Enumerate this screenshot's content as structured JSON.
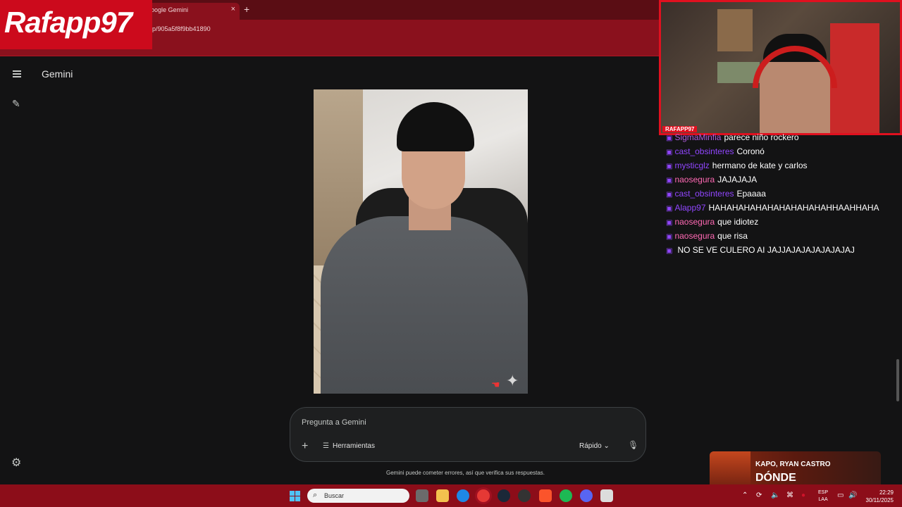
{
  "browser": {
    "tab_title": "oogle Gemini",
    "close_glyph": "×",
    "new_tab_glyph": "+",
    "url": "p/905a5f8f9bb41890"
  },
  "overlay": {
    "logo_text": "Rafapp97",
    "webcam_label": "RAFAPP97"
  },
  "gemini": {
    "app_title": "Gemini",
    "prompt_placeholder": "Pregunta a Gemini",
    "plus_glyph": "+",
    "tools_label": "Herramientas",
    "mode_label": "Rápido",
    "disclaimer": "Gemini puede cometer errores, así que verifica sus respuestas."
  },
  "chat": {
    "messages": [
      {
        "user": "SigmaMinfia",
        "text": "parece niño rockero",
        "color": "#b15be0"
      },
      {
        "user": "cast_obsinteres",
        "text": "Coronó",
        "color": "#9146ff"
      },
      {
        "user": "mysticglz",
        "text": "hermano de kate y carlos",
        "color": "#9146ff"
      },
      {
        "user": "naosegura",
        "text": "JAJAJAJA",
        "color": "#ff69b4"
      },
      {
        "user": "cast_obsinteres",
        "text": "Epaaaa",
        "color": "#9146ff"
      },
      {
        "user": "Alapp97",
        "text": "HAHAHAHAHAHAHAHAHAHAHHAAHHAHA",
        "color": "#9146ff"
      },
      {
        "user": "naosegura",
        "text": "que idiotez",
        "color": "#ff69b4"
      },
      {
        "user": "naosegura",
        "text": "que risa",
        "color": "#ff69b4"
      },
      {
        "user": "",
        "text": "NO SE VE CULERO AI JAJJAJAJAJAJAJAJAJ",
        "color": "#1f3fd6"
      }
    ]
  },
  "now_playing": {
    "artist": "KAPO, RYAN CASTRO",
    "title": "DÓNDE"
  },
  "taskbar": {
    "search_placeholder": "Buscar",
    "lang_top": "ESP",
    "lang_bottom": "LAA",
    "time": "22:29",
    "date": "30/11/2025"
  },
  "colors": {
    "accent_red": "#cc0a1c",
    "taskbar": "#8c0d19",
    "gemini_bg": "#131314"
  }
}
